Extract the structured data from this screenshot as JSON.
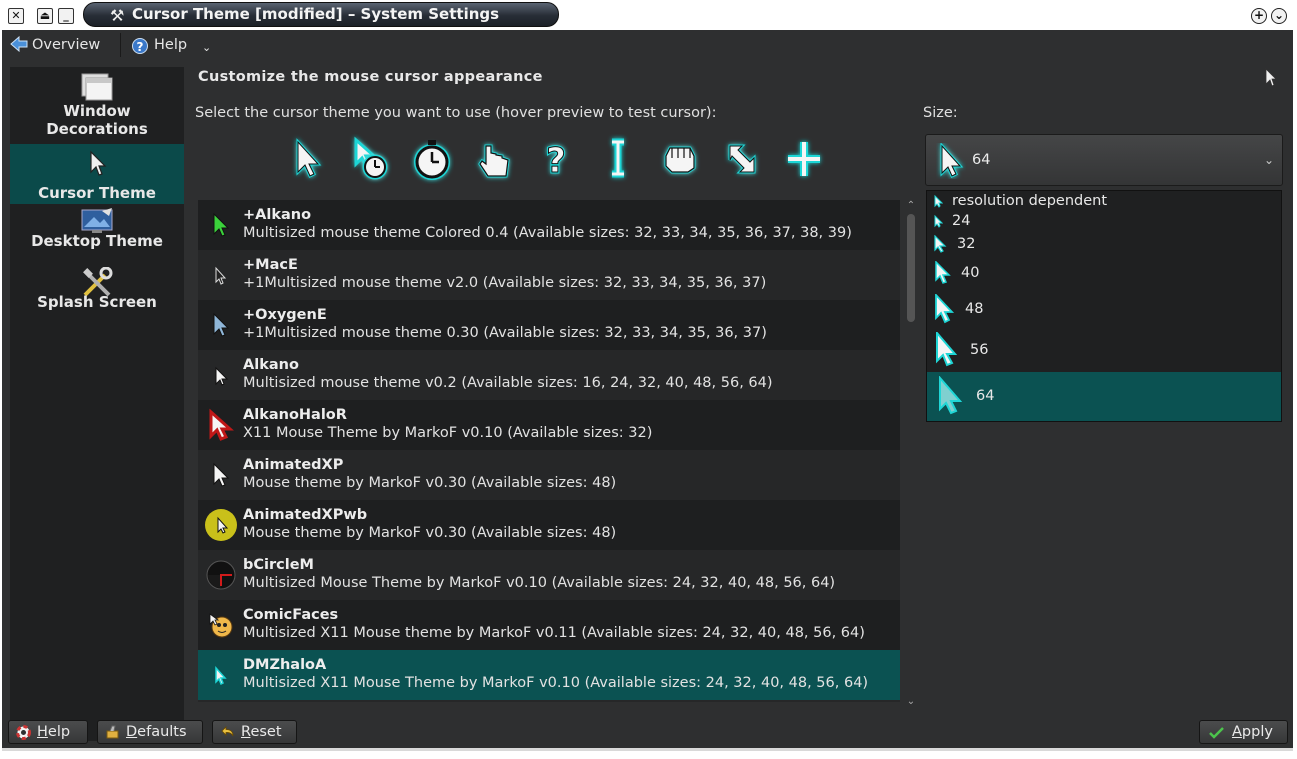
{
  "window": {
    "title": "Cursor Theme [modified] – System Settings"
  },
  "toolbar": {
    "overview_label": "Overview",
    "help_label": "Help"
  },
  "sidebar": {
    "items": [
      {
        "label_line1": "Window",
        "label_line2": "Decorations",
        "icon": "window-decorations-icon"
      },
      {
        "label_line1": "Cursor Theme",
        "label_line2": "",
        "icon": "cursor-icon"
      },
      {
        "label_line1": "Desktop Theme",
        "label_line2": "",
        "icon": "desktop-theme-icon"
      },
      {
        "label_line1": "Splash Screen",
        "label_line2": "",
        "icon": "splash-screen-icon"
      }
    ]
  },
  "content": {
    "title": "Customize the mouse cursor appearance",
    "select_label": "Select the cursor theme you want to use (hover preview to test cursor):",
    "size_label": "Size:"
  },
  "preview_cursors": [
    "arrow-cursor-icon",
    "busy-arrow-cursor-icon",
    "wait-cursor-icon",
    "pointing-hand-cursor-icon",
    "help-cursor-icon",
    "text-cursor-icon",
    "grab-hand-cursor-icon",
    "resize-diagonal-cursor-icon",
    "crosshair-cursor-icon"
  ],
  "themes": [
    {
      "name": "+Alkano",
      "desc": "Multisized mouse theme Colored 0.4 (Available sizes: 32, 33, 34, 35, 36, 37, 38, 39)"
    },
    {
      "name": "+MacE",
      "desc": "+1Multisized mouse theme v2.0 (Available sizes: 32, 33, 34, 35, 36, 37)"
    },
    {
      "name": "+OxygenE",
      "desc": "+1Multisized mouse theme 0.30 (Available sizes: 32, 33, 34, 35, 36, 37)"
    },
    {
      "name": "Alkano",
      "desc": "Multisized mouse theme v0.2 (Available sizes: 16, 24, 32, 40, 48, 56, 64)"
    },
    {
      "name": "AlkanoHaloR",
      "desc": "X11 Mouse Theme by MarkoF v0.10 (Available sizes: 32)"
    },
    {
      "name": "AnimatedXP",
      "desc": "Mouse theme by MarkoF v0.30 (Available sizes: 48)"
    },
    {
      "name": "AnimatedXPwb",
      "desc": "Mouse theme by MarkoF v0.30 (Available sizes: 48)"
    },
    {
      "name": "bCircleM",
      "desc": "Multisized Mouse Theme by MarkoF v0.10 (Available sizes: 24, 32, 40, 48, 56, 64)"
    },
    {
      "name": "ComicFaces",
      "desc": "Multisized X11 Mouse theme by MarkoF v0.11 (Available sizes: 24, 32, 40, 48, 56, 64)"
    },
    {
      "name": "DMZhaloA",
      "desc": "Multisized X11 Mouse Theme by MarkoF v0.10 (Available sizes: 24, 32, 40, 48, 56, 64)"
    }
  ],
  "size_combo": {
    "value": "64",
    "options": [
      "resolution dependent",
      "24",
      "32",
      "40",
      "48",
      "56",
      "64"
    ]
  },
  "buttons": {
    "help_first": "H",
    "help_rest": "elp",
    "defaults_first": "D",
    "defaults_rest": "efaults",
    "reset_first": "R",
    "reset_rest": "eset",
    "apply_first": "A",
    "apply_rest": "pply"
  },
  "colors": {
    "accent": "#0b5252",
    "cursor_glow": "#1fd6d6",
    "background": "#2e2f30"
  }
}
